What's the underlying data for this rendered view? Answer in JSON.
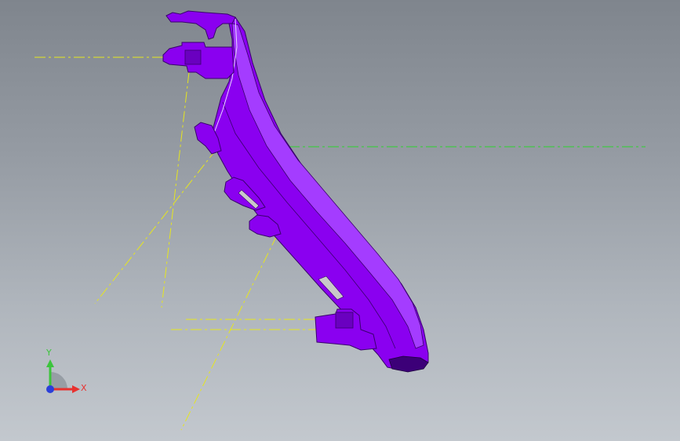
{
  "triad": {
    "x_label": "X",
    "y_label": "Y",
    "x_color": "#e8312f",
    "y_color": "#3cc43c",
    "z_color": "#2b3fd9"
  },
  "colors": {
    "part": "#8a00f0",
    "part_dark": "#5a00a8",
    "part_light": "#a43cff",
    "construction_line": "#e6e61e",
    "reference_line": "#2ed32e"
  }
}
